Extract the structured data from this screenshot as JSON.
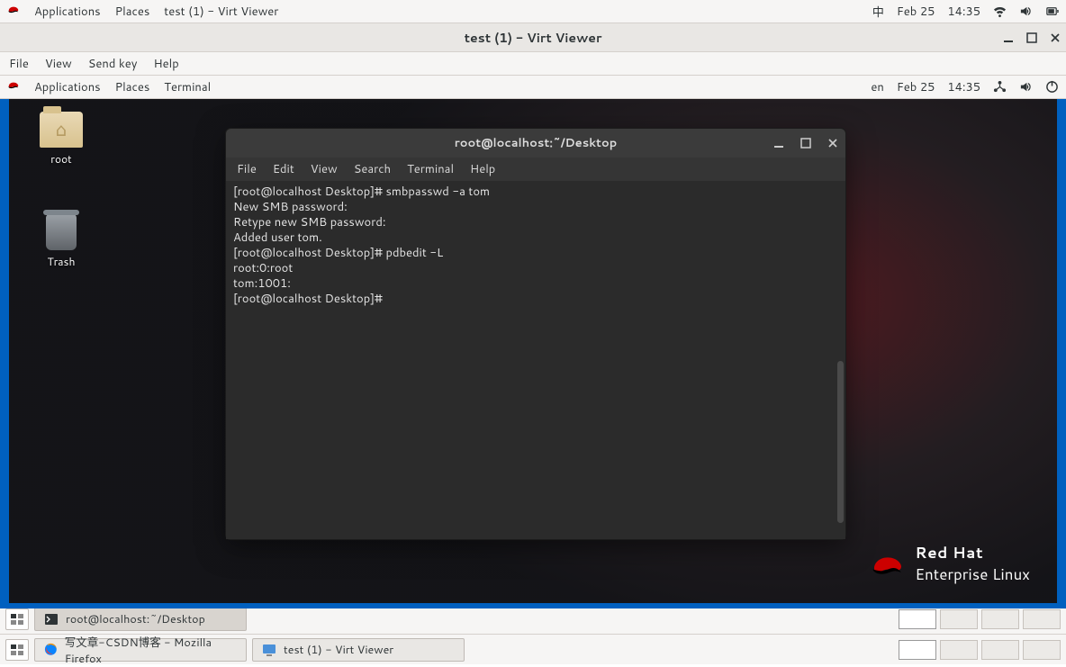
{
  "host": {
    "topbar": {
      "applications": "Applications",
      "places": "Places",
      "active_window": "test (1) - Virt Viewer",
      "ime_indicator": "中",
      "date": "Feb 25",
      "time": "14:35"
    }
  },
  "virt_viewer": {
    "title": "test (1) - Virt Viewer",
    "menu": {
      "file": "File",
      "view": "View",
      "sendkey": "Send key",
      "help": "Help"
    }
  },
  "guest": {
    "topbar": {
      "applications": "Applications",
      "places": "Places",
      "active_app": "Terminal",
      "lang_indicator": "en",
      "date": "Feb 25",
      "time": "14:35"
    },
    "desktop_icons": {
      "root_folder": "root",
      "trash": "Trash"
    },
    "brand_line1": "Red Hat",
    "brand_line2": "Enterprise Linux"
  },
  "terminal": {
    "title": "root@localhost:~/Desktop",
    "menu": {
      "file": "File",
      "edit": "Edit",
      "view": "View",
      "search": "Search",
      "terminal": "Terminal",
      "help": "Help"
    },
    "lines": [
      "[root@localhost Desktop]# smbpasswd -a tom",
      "New SMB password:",
      "Retype new SMB password:",
      "Added user tom.",
      "[root@localhost Desktop]# pdbedit -L",
      "root:0:root",
      "tom:1001:",
      "[root@localhost Desktop]# "
    ]
  },
  "host_taskbars": {
    "row1_task": "root@localhost:~/Desktop",
    "row2_task_a": "写文章-CSDN博客 - Mozilla Firefox",
    "row2_task_b": "test (1) - Virt Viewer"
  }
}
